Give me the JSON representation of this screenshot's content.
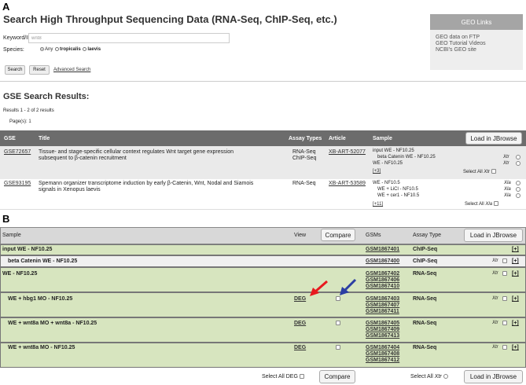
{
  "panel_a_label": "A",
  "panel_b_label": "B",
  "search": {
    "title": "Search High Throughput Sequencing Data (RNA-Seq, ChIP-Seq, etc.)",
    "keyword_label": "Keyword/ID:",
    "keyword_value": "wnt8",
    "species_label": "Species:",
    "species_options": [
      "Any",
      "tropicalis",
      "laevis"
    ],
    "search_button": "Search",
    "reset_button": "Reset",
    "advanced_link": "Advanced Search"
  },
  "geo": {
    "header": "GEO Links",
    "links": [
      "GEO data on FTP",
      "GEO Tutorial Videos",
      "NCBI's GEO site"
    ]
  },
  "results": {
    "title": "GSE Search Results:",
    "count_text": "Results 1 - 2 of 2 results",
    "pages_label": "Page(s):",
    "pages_value": "1",
    "columns": [
      "GSE",
      "Title",
      "Assay Types",
      "Article",
      "Sample"
    ],
    "load_button": "Load in JBrowse",
    "rows": [
      {
        "gse": "GSE72657",
        "title_line1": "Tissue- and stage-specific cellular context regulates Wnt target gene expression",
        "title_line2": "subsequent to β-catenin recruitment",
        "assay1": "RNA-Seq",
        "assay2": "ChIP-Seq",
        "article": "XB-ART-52077",
        "samples": [
          "input WE - NF10.25",
          "beta Catenin WE - NF10.25",
          "WE - NF10.25"
        ],
        "more": "[+3]",
        "species1": "Xtr",
        "species2": "Xtr",
        "select_all": "Select All",
        "select_all_species": "Xtr"
      },
      {
        "gse": "GSE93195",
        "title_line1": "Spemann organizer transcriptome induction by early β-Catenin, Wnt, Nodal and Siamois",
        "title_line2": "signals in Xenopus laevis",
        "assay1": "RNA-Seq",
        "article": "XB-ART-53589",
        "samples": [
          "WE - NF10.5",
          "WE + LiCl - NF10.5",
          "WE + cer1 - NF10.5"
        ],
        "more": "[+11]",
        "species1": "Xla",
        "species2": "Xla",
        "species3": "Xla",
        "select_all": "Select All",
        "select_all_species": "Xla"
      }
    ]
  },
  "detail": {
    "columns": {
      "sample": "Sample",
      "view": "View",
      "compare": "Compare",
      "gsms": "GSMs",
      "assay": "Assay Type",
      "load": "Load in JBrowse"
    },
    "rows": [
      {
        "sample": "input WE - NF10.25",
        "view": "",
        "gsms": [
          "GSM1867401"
        ],
        "assay": "ChIP-Seq",
        "species": "",
        "plus": "[+]"
      },
      {
        "sample": "beta Catenin WE - NF10.25",
        "view": "",
        "gsms": [
          "GSM1867400"
        ],
        "assay": "ChIP-Seq",
        "species": "Xtr",
        "plus": "[+]"
      },
      {
        "sample": "WE - NF10.25",
        "view": "",
        "gsms": [
          "GSM1867402",
          "GSM1867406",
          "GSM1867410"
        ],
        "assay": "RNA-Seq",
        "species": "Xtr",
        "plus": "[+]"
      },
      {
        "sample": "WE + hbg1 MO - NF10.25",
        "view": "DEG",
        "gsms": [
          "GSM1867403",
          "GSM1867407",
          "GSM1867411"
        ],
        "assay": "RNA-Seq",
        "species": "Xtr",
        "plus": "[+]"
      },
      {
        "sample": "WE + wnt8a MO + wnt8a - NF10.25",
        "view": "DEG",
        "gsms": [
          "GSM1867405",
          "GSM1867409",
          "GSM1867413"
        ],
        "assay": "RNA-Seq",
        "species": "Xtr",
        "plus": "[+]"
      },
      {
        "sample": "WE + wnt8a MO - NF10.25",
        "view": "DEG",
        "gsms": [
          "GSM1867404",
          "GSM1867408",
          "GSM1867412"
        ],
        "assay": "RNA-Seq",
        "species": "Xtr",
        "plus": "[+]"
      }
    ],
    "footer": {
      "select_all_deg": "Select All DEG",
      "compare_button": "Compare",
      "select_all": "Select All",
      "species": "Xtr",
      "load_button": "Load in JBrowse"
    },
    "arrow_colors": {
      "red": "#e8191f",
      "blue": "#2b3ea3"
    }
  }
}
